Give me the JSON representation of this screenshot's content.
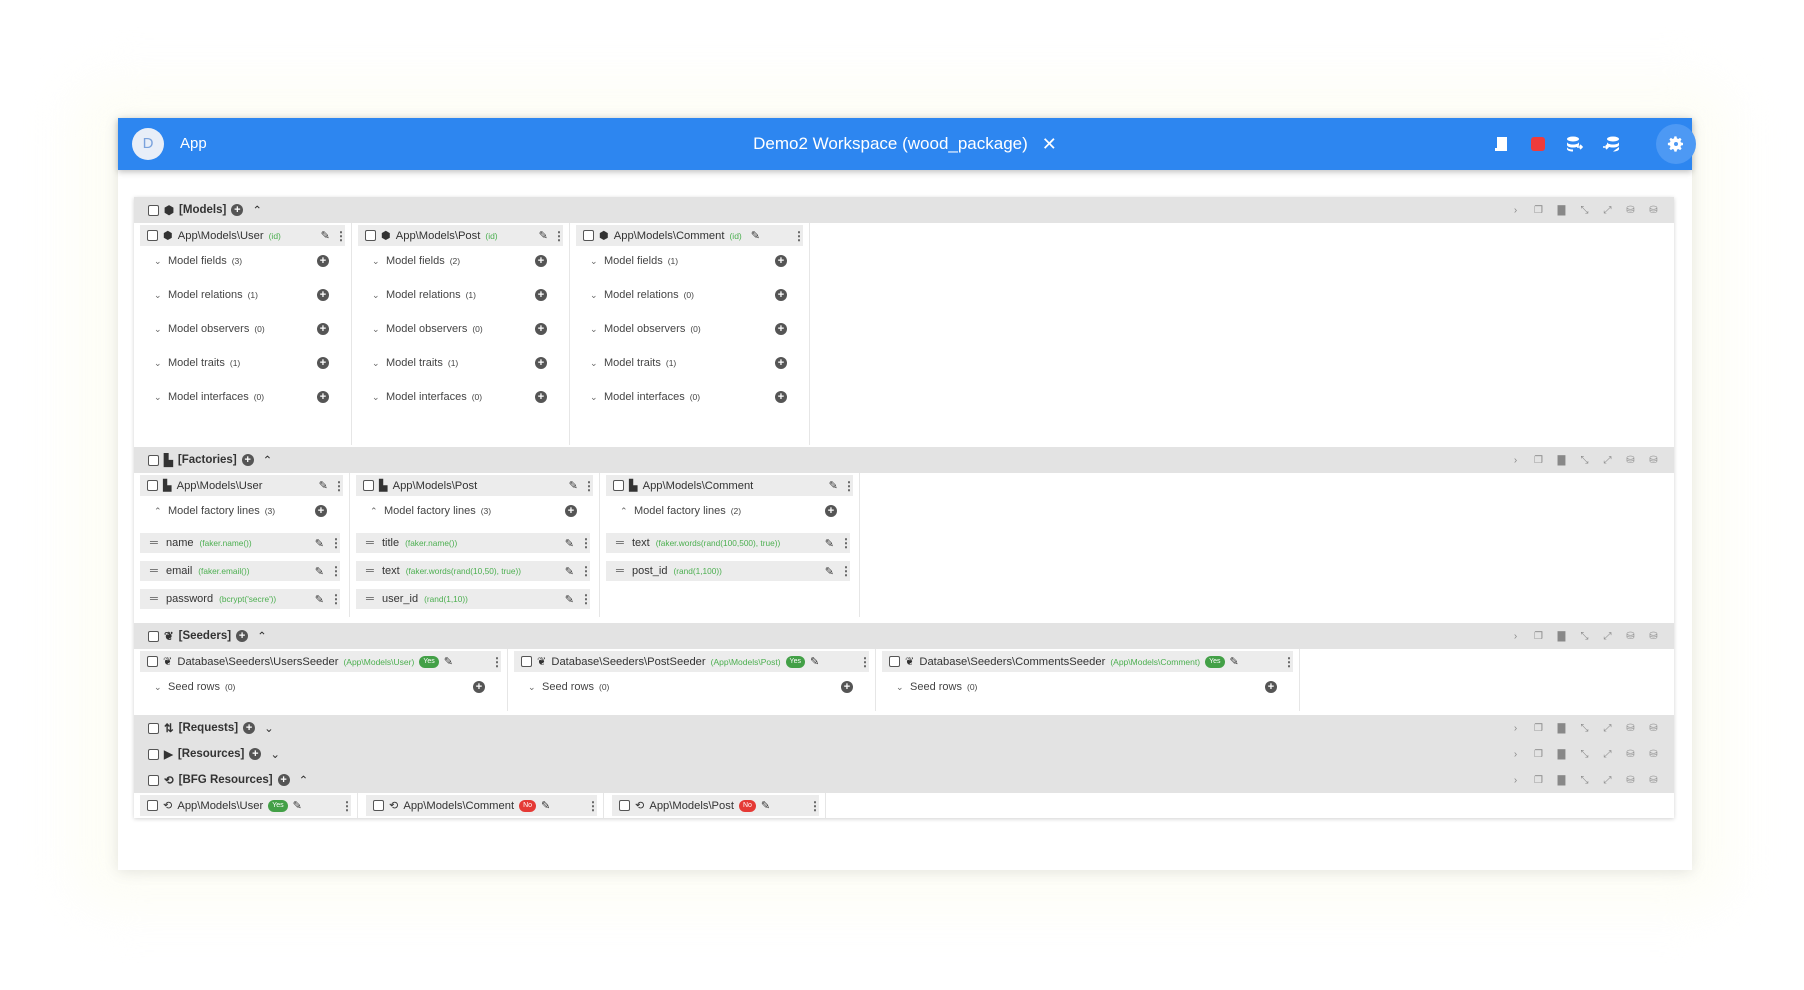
{
  "appbar": {
    "avatar": "D",
    "app_label": "App",
    "title": "Demo2 Workspace (wood_package)",
    "close": "✕",
    "accent": "#2d86f0"
  },
  "sections": {
    "models": {
      "label": "[Models]"
    },
    "factories": {
      "label": "[Factories]"
    },
    "seeders": {
      "label": "[Seeders]"
    },
    "requests": {
      "label": "[Requests]"
    },
    "resources": {
      "label": "[Resources]"
    },
    "bfg": {
      "label": "[BFG Resources]"
    }
  },
  "model_cards": [
    {
      "name": "App\\Models\\User",
      "key": "(id)",
      "rows": [
        {
          "label": "Model fields",
          "count": "(3)"
        },
        {
          "label": "Model relations",
          "count": "(1)"
        },
        {
          "label": "Model observers",
          "count": "(0)"
        },
        {
          "label": "Model traits",
          "count": "(1)"
        },
        {
          "label": "Model interfaces",
          "count": "(0)"
        }
      ]
    },
    {
      "name": "App\\Models\\Post",
      "key": "(id)",
      "rows": [
        {
          "label": "Model fields",
          "count": "(2)"
        },
        {
          "label": "Model relations",
          "count": "(1)"
        },
        {
          "label": "Model observers",
          "count": "(0)"
        },
        {
          "label": "Model traits",
          "count": "(1)"
        },
        {
          "label": "Model interfaces",
          "count": "(0)"
        }
      ]
    },
    {
      "name": "App\\Models\\Comment",
      "key": "(id)",
      "rows": [
        {
          "label": "Model fields",
          "count": "(1)"
        },
        {
          "label": "Model relations",
          "count": "(0)"
        },
        {
          "label": "Model observers",
          "count": "(0)"
        },
        {
          "label": "Model traits",
          "count": "(1)"
        },
        {
          "label": "Model interfaces",
          "count": "(0)"
        }
      ]
    }
  ],
  "factory_cards": [
    {
      "name": "App\\Models\\User",
      "lines_label": "Model factory lines",
      "count": "(3)",
      "lines": [
        {
          "field": "name",
          "expr": "(faker.name())"
        },
        {
          "field": "email",
          "expr": "(faker.email())"
        },
        {
          "field": "password",
          "expr": "(bcrypt('secre'))"
        }
      ]
    },
    {
      "name": "App\\Models\\Post",
      "lines_label": "Model factory lines",
      "count": "(3)",
      "lines": [
        {
          "field": "title",
          "expr": "(faker.name())"
        },
        {
          "field": "text",
          "expr": "(faker.words(rand(10,50), true))"
        },
        {
          "field": "user_id",
          "expr": "(rand(1,10))"
        }
      ]
    },
    {
      "name": "App\\Models\\Comment",
      "lines_label": "Model factory lines",
      "count": "(2)",
      "lines": [
        {
          "field": "text",
          "expr": "(faker.words(rand(100,500), true))"
        },
        {
          "field": "post_id",
          "expr": "(rand(1,100))"
        }
      ]
    }
  ],
  "seeder_cards": [
    {
      "name": "Database\\Seeders\\UsersSeeder",
      "model": "(App\\Models\\User)",
      "badge": "Yes",
      "rows_label": "Seed rows",
      "count": "(0)"
    },
    {
      "name": "Database\\Seeders\\PostSeeder",
      "model": "(App\\Models\\Post)",
      "badge": "Yes",
      "rows_label": "Seed rows",
      "count": "(0)"
    },
    {
      "name": "Database\\Seeders\\CommentsSeeder",
      "model": "(App\\Models\\Comment)",
      "badge": "Yes",
      "rows_label": "Seed rows",
      "count": "(0)"
    }
  ],
  "bfg_cards": [
    {
      "name": "App\\Models\\User",
      "badge": "Yes"
    },
    {
      "name": "App\\Models\\Comment",
      "badge": "No"
    },
    {
      "name": "App\\Models\\Post",
      "badge": "No"
    }
  ],
  "icons": {
    "model": "cube-icon",
    "factory": "factory-icon",
    "seeder": "sprout-icon",
    "request": "request-icon",
    "resource": "play-box-icon",
    "bfg": "bfg-icon"
  }
}
